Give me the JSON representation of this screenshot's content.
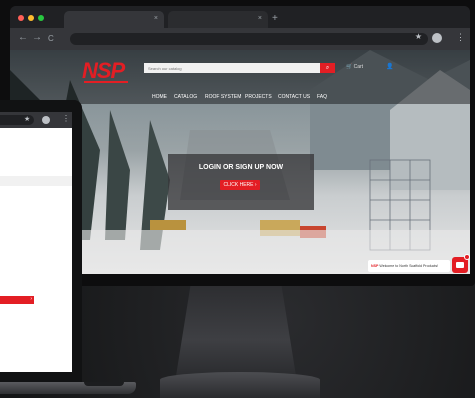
{
  "browser": {
    "tabs": [
      {
        "label": "",
        "active": true
      },
      {
        "label": "",
        "active": false
      }
    ],
    "new_tab": "+",
    "back": "←",
    "forward": "→",
    "reload": "C",
    "menu": "⋮"
  },
  "site": {
    "logo": "NSP",
    "search_placeholder": "Search our catalog",
    "search_icon": "search-icon",
    "header_links": {
      "cart": "Cart",
      "account": "Account"
    },
    "nav": [
      "HOME",
      "CATALOG",
      "ROOF SYSTEM",
      "PROJECTS",
      "CONTACT US",
      "FAQ"
    ],
    "hero": {
      "title": "LOGIN OR SIGN UP NOW",
      "button": "CLICK HERE ›"
    },
    "chat": {
      "brand": "NSP",
      "message": "Welcome to North Scaffold Products!"
    }
  },
  "colors": {
    "brand_red": "#e31e24",
    "browser_dark": "#202124",
    "browser_toolbar": "#35363a"
  }
}
